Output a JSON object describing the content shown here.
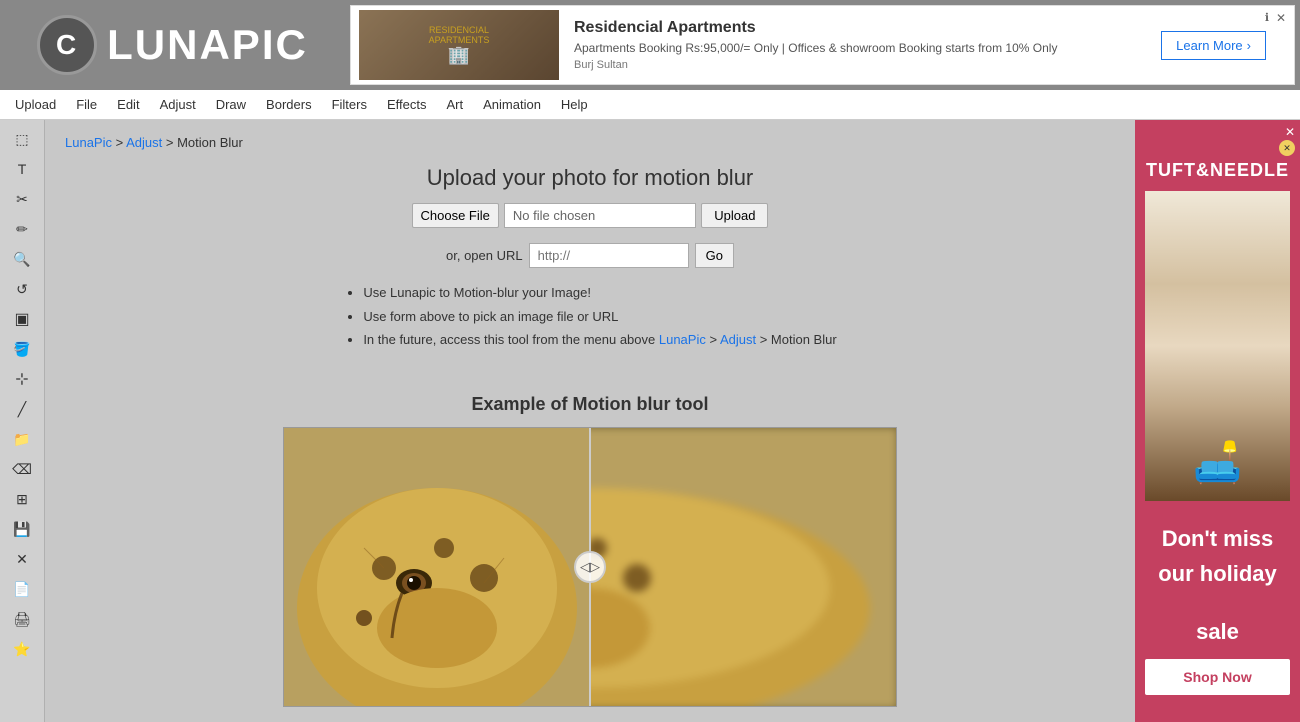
{
  "header": {
    "logo_text": "LUNAPIC",
    "logo_circle": "C",
    "ad": {
      "title": "Residencial Apartments",
      "description": "Apartments Booking Rs:95,000/= Only | Offices & showroom Booking starts from 10% Only",
      "location": "Burj Sultan",
      "cta_label": "Learn More",
      "close_label": "✕",
      "info_label": "ℹ"
    }
  },
  "nav": {
    "items": [
      "Upload",
      "File",
      "Edit",
      "Adjust",
      "Draw",
      "Borders",
      "Filters",
      "Effects",
      "Art",
      "Animation",
      "Help"
    ]
  },
  "breadcrumb": {
    "site": "LunaPic",
    "separator1": " > ",
    "section": "Adjust",
    "separator2": " > ",
    "current": "Motion Blur"
  },
  "upload": {
    "title": "Upload your photo for motion blur",
    "choose_file": "Choose File",
    "no_file": "No file chosen",
    "upload_btn": "Upload",
    "url_label": "or, open URL",
    "url_placeholder": "http://",
    "go_btn": "Go"
  },
  "instructions": {
    "items": [
      "Use Lunapic to Motion-blur your Image!",
      "Use form above to pick an image file or URL",
      "In the future, access this tool from the menu above"
    ],
    "link_site": "LunaPic",
    "link_section": "Adjust",
    "link_trail": "> Motion Blur"
  },
  "example": {
    "title": "Example of Motion blur tool",
    "handle_icon": "◁▷"
  },
  "right_ad": {
    "brand": "TUFT&NEEDLE",
    "sale_line1": "Don't miss",
    "sale_line2": "our holiday",
    "sale_line3": "sale",
    "shop_now": "Shop Now",
    "close": "✕"
  },
  "toolbar": {
    "tools": [
      {
        "name": "select",
        "icon": "⬚"
      },
      {
        "name": "text",
        "icon": "T"
      },
      {
        "name": "scissors",
        "icon": "✂"
      },
      {
        "name": "pencil",
        "icon": "✏"
      },
      {
        "name": "zoom",
        "icon": "🔍"
      },
      {
        "name": "undo",
        "icon": "↺"
      },
      {
        "name": "crop",
        "icon": "▣"
      },
      {
        "name": "bucket",
        "icon": "🪣"
      },
      {
        "name": "eyedropper",
        "icon": "💉"
      },
      {
        "name": "brush",
        "icon": "🖌"
      },
      {
        "name": "folder",
        "icon": "📁"
      },
      {
        "name": "eraser",
        "icon": "⌫"
      },
      {
        "name": "layers",
        "icon": "⊞"
      },
      {
        "name": "save",
        "icon": "💾"
      },
      {
        "name": "close",
        "icon": "✕"
      },
      {
        "name": "page",
        "icon": "📄"
      },
      {
        "name": "stamp",
        "icon": "🖨"
      },
      {
        "name": "sticker",
        "icon": "⭐"
      }
    ]
  }
}
